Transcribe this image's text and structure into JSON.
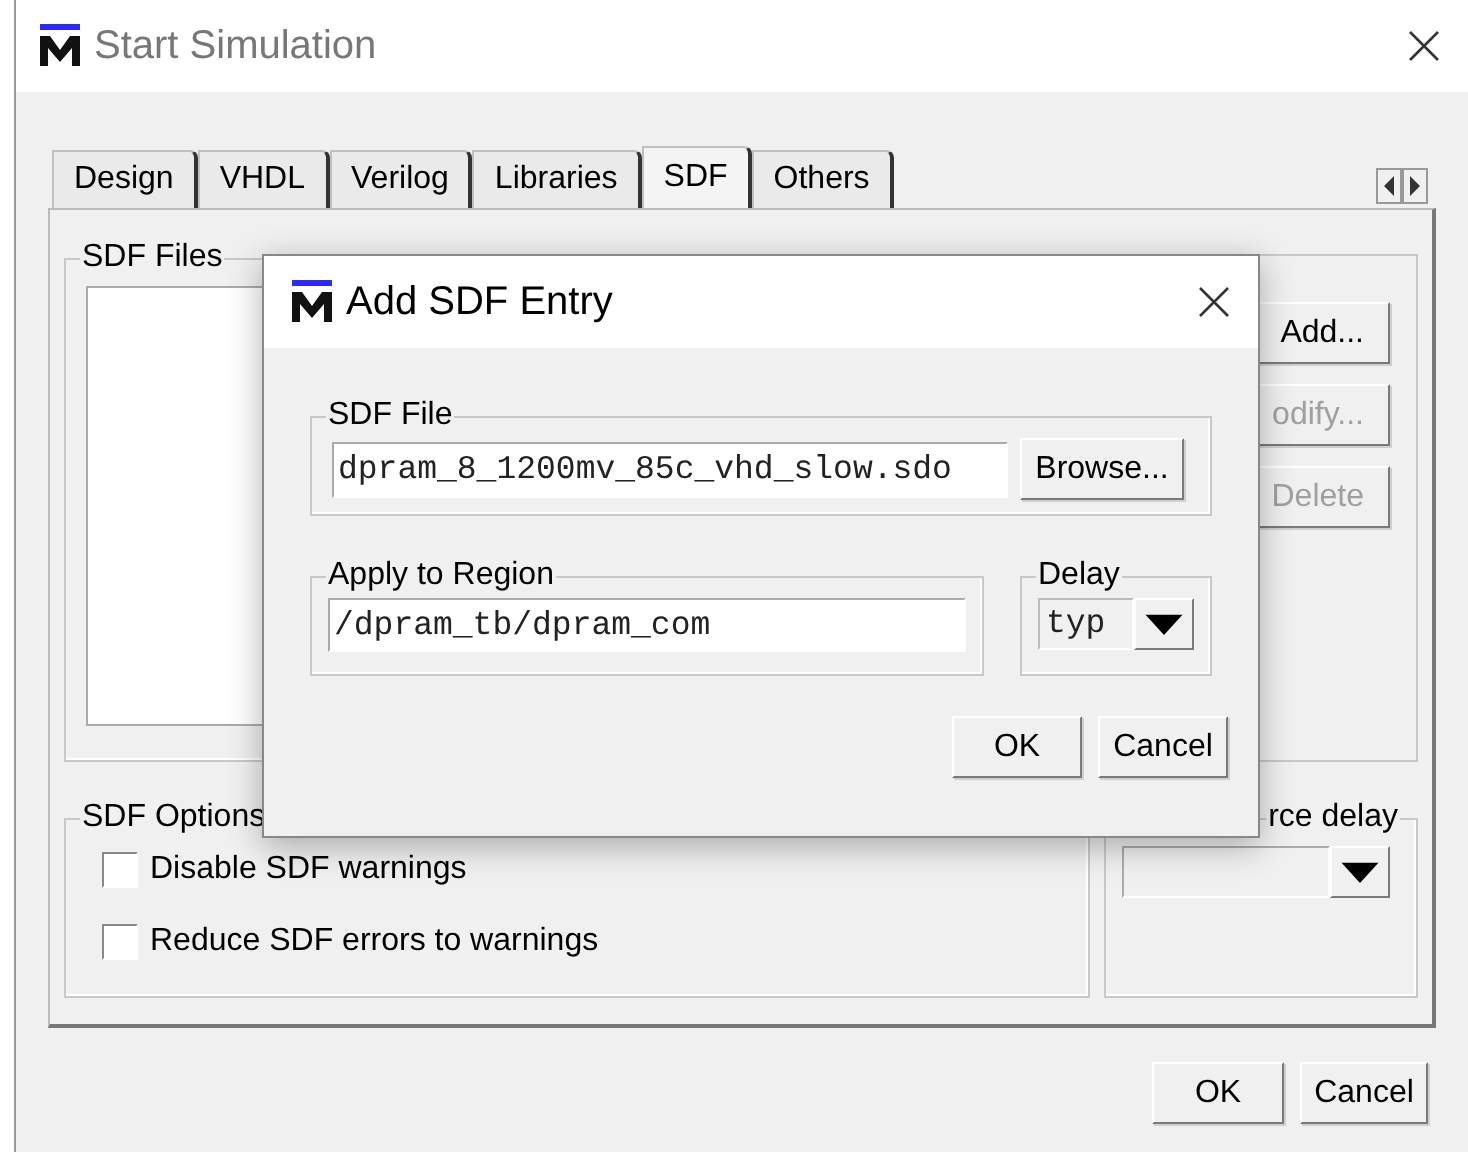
{
  "window": {
    "title": "Start Simulation"
  },
  "tabs": [
    {
      "label": "Design",
      "selected": false
    },
    {
      "label": "VHDL",
      "selected": false
    },
    {
      "label": "Verilog",
      "selected": false
    },
    {
      "label": "Libraries",
      "selected": false
    },
    {
      "label": "SDF",
      "selected": true
    },
    {
      "label": "Others",
      "selected": false
    }
  ],
  "sdf_files": {
    "label": "SDF Files",
    "buttons": [
      {
        "label": "Add...",
        "disabled": false
      },
      {
        "label": "odify...",
        "disabled": true
      },
      {
        "label": "Delete",
        "disabled": true
      }
    ]
  },
  "sdf_options": {
    "label": "SDF Options",
    "checkboxes": [
      {
        "label": "Disable SDF warnings",
        "checked": false
      },
      {
        "label": "Reduce SDF errors to warnings",
        "checked": false
      }
    ]
  },
  "multi_source_delay": {
    "label": "rce delay"
  },
  "buttons": [
    "OK",
    "Cancel"
  ],
  "dialog": {
    "title": "Add SDF Entry",
    "sdf_file": {
      "label": "SDF File",
      "value": "dpram_8_1200mv_85c_vhd_slow.sdo",
      "browse": "Browse..."
    },
    "region": {
      "label": "Apply to Region",
      "value": "/dpram_tb/dpram_com"
    },
    "delay": {
      "label": "Delay",
      "value": "typ"
    },
    "buttons": [
      "OK",
      "Cancel"
    ]
  }
}
